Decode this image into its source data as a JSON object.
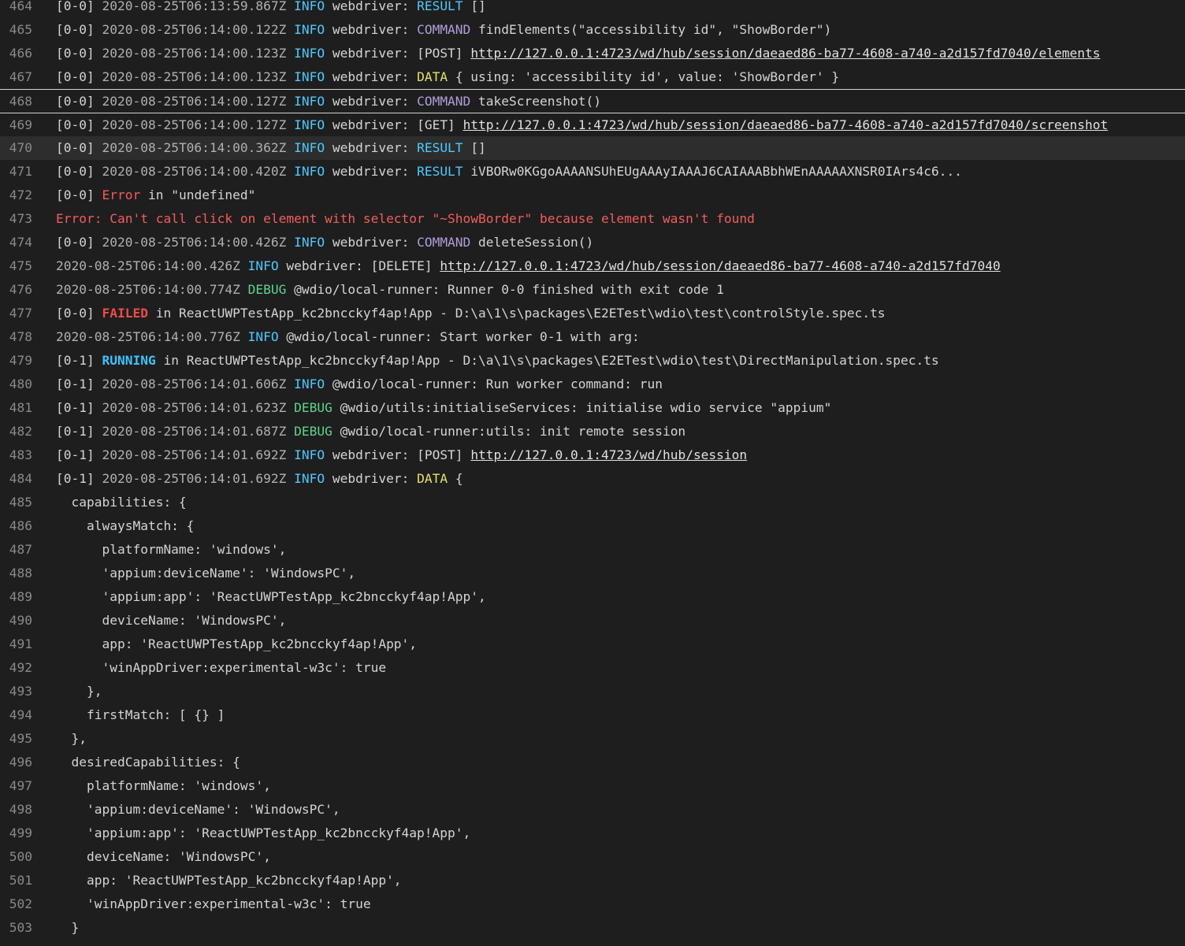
{
  "colors": {
    "background": "#1e1e1e",
    "text": "#d4d4d4",
    "line_number": "#8a8a8a",
    "info": "#4ec9ff",
    "debug": "#5fd38d",
    "command": "#b39ddb",
    "data": "#e5e06a",
    "error": "#f25c5c"
  },
  "log": {
    "lines": [
      {
        "n": "464",
        "tokens": [
          {
            "t": "[0-0] ",
            "c": "text"
          },
          {
            "t": "2020-08-25T06:13:59.867Z ",
            "c": "dim"
          },
          {
            "t": "INFO ",
            "c": "info"
          },
          {
            "t": "webdriver: ",
            "c": "text"
          },
          {
            "t": "RESULT ",
            "c": "result"
          },
          {
            "t": "[]",
            "c": "text"
          }
        ]
      },
      {
        "n": "465",
        "tokens": [
          {
            "t": "[0-0] ",
            "c": "text"
          },
          {
            "t": "2020-08-25T06:14:00.122Z ",
            "c": "dim"
          },
          {
            "t": "INFO ",
            "c": "info"
          },
          {
            "t": "webdriver: ",
            "c": "text"
          },
          {
            "t": "COMMAND ",
            "c": "cmd"
          },
          {
            "t": "findElements(\"accessibility id\", \"ShowBorder\")",
            "c": "text"
          }
        ]
      },
      {
        "n": "466",
        "tokens": [
          {
            "t": "[0-0] ",
            "c": "text"
          },
          {
            "t": "2020-08-25T06:14:00.123Z ",
            "c": "dim"
          },
          {
            "t": "INFO ",
            "c": "info"
          },
          {
            "t": "webdriver: ",
            "c": "text"
          },
          {
            "t": "[POST] ",
            "c": "text"
          },
          {
            "t": "http://127.0.0.1:4723/wd/hub/session/daeaed86-ba77-4608-a740-a2d157fd7040/elements",
            "c": "link"
          }
        ]
      },
      {
        "n": "467",
        "tokens": [
          {
            "t": "[0-0] ",
            "c": "text"
          },
          {
            "t": "2020-08-25T06:14:00.123Z ",
            "c": "dim"
          },
          {
            "t": "INFO ",
            "c": "info"
          },
          {
            "t": "webdriver: ",
            "c": "text"
          },
          {
            "t": "DATA ",
            "c": "data"
          },
          {
            "t": "{ using: 'accessibility id', value: 'ShowBorder' }",
            "c": "text"
          }
        ]
      },
      {
        "n": "468",
        "sel": "top",
        "tokens": [
          {
            "t": "[0-0] ",
            "c": "text"
          },
          {
            "t": "2020-08-25T06:14:00.127Z ",
            "c": "dim"
          },
          {
            "t": "INFO ",
            "c": "info"
          },
          {
            "t": "webdriver: ",
            "c": "text"
          },
          {
            "t": "COMMAND ",
            "c": "cmd"
          },
          {
            "t": "takeScreenshot()",
            "c": "text"
          }
        ]
      },
      {
        "n": "469",
        "sel": "top",
        "tokens": [
          {
            "t": "[0-0] ",
            "c": "text"
          },
          {
            "t": "2020-08-25T06:14:00.127Z ",
            "c": "dim"
          },
          {
            "t": "INFO ",
            "c": "info"
          },
          {
            "t": "webdriver: ",
            "c": "text"
          },
          {
            "t": "[GET] ",
            "c": "text"
          },
          {
            "t": "http://127.0.0.1:4723/wd/hub/session/daeaed86-ba77-4608-a740-a2d157fd7040/screenshot",
            "c": "link"
          }
        ]
      },
      {
        "n": "470",
        "hover": true,
        "tokens": [
          {
            "t": "[0-0] ",
            "c": "text"
          },
          {
            "t": "2020-08-25T06:14:00.362Z ",
            "c": "dim"
          },
          {
            "t": "INFO ",
            "c": "info"
          },
          {
            "t": "webdriver: ",
            "c": "text"
          },
          {
            "t": "RESULT ",
            "c": "result"
          },
          {
            "t": "[]",
            "c": "text"
          }
        ]
      },
      {
        "n": "471",
        "tokens": [
          {
            "t": "[0-0] ",
            "c": "text"
          },
          {
            "t": "2020-08-25T06:14:00.420Z ",
            "c": "dim"
          },
          {
            "t": "INFO ",
            "c": "info"
          },
          {
            "t": "webdriver: ",
            "c": "text"
          },
          {
            "t": "RESULT ",
            "c": "result"
          },
          {
            "t": "iVBORw0KGgoAAAANSUhEUgAAAyIAAAJ6CAIAAABbhWEnAAAAAXNSR0IArs4c6...",
            "c": "text"
          }
        ]
      },
      {
        "n": "472",
        "tokens": [
          {
            "t": "[0-0] ",
            "c": "text"
          },
          {
            "t": "Error ",
            "c": "err"
          },
          {
            "t": "in \"undefined\"",
            "c": "text"
          }
        ]
      },
      {
        "n": "473",
        "tokens": [
          {
            "t": "Error: Can't call click on element with selector \"~ShowBorder\" because element wasn't found",
            "c": "err"
          }
        ]
      },
      {
        "n": "474",
        "tokens": [
          {
            "t": "[0-0] ",
            "c": "text"
          },
          {
            "t": "2020-08-25T06:14:00.426Z ",
            "c": "dim"
          },
          {
            "t": "INFO ",
            "c": "info"
          },
          {
            "t": "webdriver: ",
            "c": "text"
          },
          {
            "t": "COMMAND ",
            "c": "cmd"
          },
          {
            "t": "deleteSession()",
            "c": "text"
          }
        ]
      },
      {
        "n": "475",
        "tokens": [
          {
            "t": "2020-08-25T06:14:00.426Z ",
            "c": "dim"
          },
          {
            "t": "INFO ",
            "c": "info"
          },
          {
            "t": "webdriver: ",
            "c": "text"
          },
          {
            "t": "[DELETE] ",
            "c": "text"
          },
          {
            "t": "http://127.0.0.1:4723/wd/hub/session/daeaed86-ba77-4608-a740-a2d157fd7040",
            "c": "link"
          }
        ]
      },
      {
        "n": "476",
        "tokens": [
          {
            "t": "2020-08-25T06:14:00.774Z ",
            "c": "dim"
          },
          {
            "t": "DEBUG ",
            "c": "debug"
          },
          {
            "t": "@wdio/local-runner: Runner 0-0 finished with exit code 1",
            "c": "text"
          }
        ]
      },
      {
        "n": "477",
        "tokens": [
          {
            "t": "[0-0] ",
            "c": "text"
          },
          {
            "t": "FAILED",
            "c": "failed"
          },
          {
            "t": " in ReactUWPTestApp_kc2bncckyf4ap!App - D:\\a\\1\\s\\packages\\E2ETest\\wdio\\test\\controlStyle.spec.ts",
            "c": "text"
          }
        ]
      },
      {
        "n": "478",
        "tokens": [
          {
            "t": "2020-08-25T06:14:00.776Z ",
            "c": "dim"
          },
          {
            "t": "INFO ",
            "c": "info"
          },
          {
            "t": "@wdio/local-runner: Start worker 0-1 with arg:",
            "c": "text"
          }
        ]
      },
      {
        "n": "479",
        "tokens": [
          {
            "t": "[0-1] ",
            "c": "text"
          },
          {
            "t": "RUNNING",
            "c": "running"
          },
          {
            "t": " in ReactUWPTestApp_kc2bncckyf4ap!App - D:\\a\\1\\s\\packages\\E2ETest\\wdio\\test\\DirectManipulation.spec.ts",
            "c": "text"
          }
        ]
      },
      {
        "n": "480",
        "tokens": [
          {
            "t": "[0-1] ",
            "c": "text"
          },
          {
            "t": "2020-08-25T06:14:01.606Z ",
            "c": "dim"
          },
          {
            "t": "INFO ",
            "c": "info"
          },
          {
            "t": "@wdio/local-runner: Run worker command: run",
            "c": "text"
          }
        ]
      },
      {
        "n": "481",
        "tokens": [
          {
            "t": "[0-1] ",
            "c": "text"
          },
          {
            "t": "2020-08-25T06:14:01.623Z ",
            "c": "dim"
          },
          {
            "t": "DEBUG ",
            "c": "debug"
          },
          {
            "t": "@wdio/utils:initialiseServices: initialise wdio service \"appium\"",
            "c": "text"
          }
        ]
      },
      {
        "n": "482",
        "tokens": [
          {
            "t": "[0-1] ",
            "c": "text"
          },
          {
            "t": "2020-08-25T06:14:01.687Z ",
            "c": "dim"
          },
          {
            "t": "DEBUG ",
            "c": "debug"
          },
          {
            "t": "@wdio/local-runner:utils: init remote session",
            "c": "text"
          }
        ]
      },
      {
        "n": "483",
        "tokens": [
          {
            "t": "[0-1] ",
            "c": "text"
          },
          {
            "t": "2020-08-25T06:14:01.692Z ",
            "c": "dim"
          },
          {
            "t": "INFO ",
            "c": "info"
          },
          {
            "t": "webdriver: ",
            "c": "text"
          },
          {
            "t": "[POST] ",
            "c": "text"
          },
          {
            "t": "http://127.0.0.1:4723/wd/hub/session",
            "c": "link"
          }
        ]
      },
      {
        "n": "484",
        "tokens": [
          {
            "t": "[0-1] ",
            "c": "text"
          },
          {
            "t": "2020-08-25T06:14:01.692Z ",
            "c": "dim"
          },
          {
            "t": "INFO ",
            "c": "info"
          },
          {
            "t": "webdriver: ",
            "c": "text"
          },
          {
            "t": "DATA ",
            "c": "data"
          },
          {
            "t": "{",
            "c": "text"
          }
        ]
      },
      {
        "n": "485",
        "tokens": [
          {
            "t": "  capabilities: {",
            "c": "text"
          }
        ]
      },
      {
        "n": "486",
        "tokens": [
          {
            "t": "    alwaysMatch: {",
            "c": "text"
          }
        ]
      },
      {
        "n": "487",
        "tokens": [
          {
            "t": "      platformName: 'windows',",
            "c": "text"
          }
        ]
      },
      {
        "n": "488",
        "tokens": [
          {
            "t": "      'appium:deviceName': 'WindowsPC',",
            "c": "text"
          }
        ]
      },
      {
        "n": "489",
        "tokens": [
          {
            "t": "      'appium:app': 'ReactUWPTestApp_kc2bncckyf4ap!App',",
            "c": "text"
          }
        ]
      },
      {
        "n": "490",
        "tokens": [
          {
            "t": "      deviceName: 'WindowsPC',",
            "c": "text"
          }
        ]
      },
      {
        "n": "491",
        "tokens": [
          {
            "t": "      app: 'ReactUWPTestApp_kc2bncckyf4ap!App',",
            "c": "text"
          }
        ]
      },
      {
        "n": "492",
        "tokens": [
          {
            "t": "      'winAppDriver:experimental-w3c': true",
            "c": "text"
          }
        ]
      },
      {
        "n": "493",
        "tokens": [
          {
            "t": "    },",
            "c": "text"
          }
        ]
      },
      {
        "n": "494",
        "tokens": [
          {
            "t": "    firstMatch: [ {} ]",
            "c": "text"
          }
        ]
      },
      {
        "n": "495",
        "tokens": [
          {
            "t": "  },",
            "c": "text"
          }
        ]
      },
      {
        "n": "496",
        "tokens": [
          {
            "t": "  desiredCapabilities: {",
            "c": "text"
          }
        ]
      },
      {
        "n": "497",
        "tokens": [
          {
            "t": "    platformName: 'windows',",
            "c": "text"
          }
        ]
      },
      {
        "n": "498",
        "tokens": [
          {
            "t": "    'appium:deviceName': 'WindowsPC',",
            "c": "text"
          }
        ]
      },
      {
        "n": "499",
        "tokens": [
          {
            "t": "    'appium:app': 'ReactUWPTestApp_kc2bncckyf4ap!App',",
            "c": "text"
          }
        ]
      },
      {
        "n": "500",
        "tokens": [
          {
            "t": "    deviceName: 'WindowsPC',",
            "c": "text"
          }
        ]
      },
      {
        "n": "501",
        "tokens": [
          {
            "t": "    app: 'ReactUWPTestApp_kc2bncckyf4ap!App',",
            "c": "text"
          }
        ]
      },
      {
        "n": "502",
        "tokens": [
          {
            "t": "    'winAppDriver:experimental-w3c': true",
            "c": "text"
          }
        ]
      },
      {
        "n": "503",
        "tokens": [
          {
            "t": "  }",
            "c": "text"
          }
        ]
      }
    ]
  }
}
